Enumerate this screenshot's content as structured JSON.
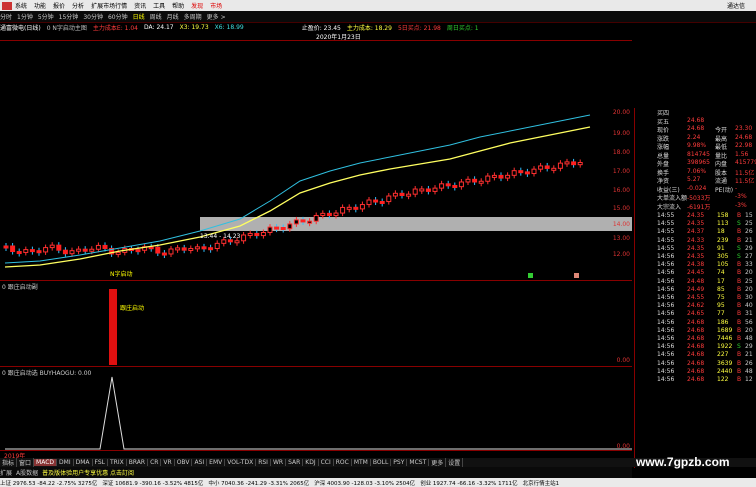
{
  "menu": {
    "items": [
      "系统",
      "功能",
      "报价",
      "分析",
      "扩展市场行情",
      "资讯",
      "工具",
      "帮助"
    ],
    "highlight": [
      "发现",
      "市场"
    ],
    "right": "通达信"
  },
  "periods": {
    "items": [
      "分时",
      "1分钟",
      "5分钟",
      "15分钟",
      "30分钟",
      "60分钟",
      "日线",
      "周线",
      "月线",
      "多周期",
      "更多 >"
    ],
    "selected": "日线"
  },
  "info": {
    "stock": "通富微电(日线)",
    "indicator": "0 N字启动主图",
    "ma": "主力成本E: 1.04",
    "da": "DA: 24.17",
    "x3": "X3: 19.73",
    "x6": "X6: 18.99",
    "stop": "止盈价: 23.45",
    "cost": "主力成本: 18.29",
    "buy1": "5日买点: 21.98",
    "buy2": "周日买点: 1",
    "date": "2020年1月23日"
  },
  "main_chart": {
    "y_labels": [
      "20.00",
      "19.00",
      "18.00",
      "17.00",
      "16.00",
      "15.00",
      "14.00",
      "13.00",
      "12.00"
    ],
    "zone_label": "13.44 - 14.23",
    "signal_text": "N字启动",
    "buy_marker": "买"
  },
  "panel2": {
    "title": "0 跟庄启动副",
    "signal": "跟庄启动",
    "y_labels": [
      "0.00"
    ]
  },
  "panel3": {
    "title": "0 跟庄启动选 BUYHAOGU: 0.00",
    "y_labels": [
      "0.00"
    ]
  },
  "quote": {
    "rows": [
      {
        "l1": "买四",
        "v1": "",
        "l2": "",
        "v2": ""
      },
      {
        "l1": "买五",
        "v1": "24.68",
        "l2": "",
        "v2": ""
      },
      {
        "l1": "现价",
        "v1": "24.68",
        "l2": "今开",
        "v2": "23.30"
      },
      {
        "l1": "涨跌",
        "v1": "2.24",
        "l2": "最高",
        "v2": "24.68"
      },
      {
        "l1": "涨幅",
        "v1": "9.98%",
        "l2": "最低",
        "v2": "22.98"
      },
      {
        "l1": "总量",
        "v1": "814745",
        "l2": "量比",
        "v2": "1.56"
      },
      {
        "l1": "外盘",
        "v1": "398965",
        "l2": "内盘",
        "v2": "415779"
      },
      {
        "l1": "换手",
        "v1": "7.06%",
        "l2": "股本",
        "v2": "11.5亿"
      },
      {
        "l1": "净资",
        "v1": "5.27",
        "l2": "流通",
        "v2": "11.5亿"
      },
      {
        "l1": "收益(三)",
        "v1": "-0.024",
        "l2": "PE(动)",
        "v2": "-"
      },
      {
        "l1": "大单流入额",
        "v1": "-5033万",
        "l2": "",
        "v2": "-3%"
      },
      {
        "l1": "大宗流入",
        "v1": "-6191万",
        "l2": "",
        "v2": "-3%"
      }
    ],
    "ticks": [
      {
        "t": "14:55",
        "p": "24.35",
        "v": "158",
        "d": "B",
        "c": "15"
      },
      {
        "t": "14:55",
        "p": "24.35",
        "v": "113",
        "d": "S",
        "c": "25"
      },
      {
        "t": "14:55",
        "p": "24.37",
        "v": "18",
        "d": "B",
        "c": "26"
      },
      {
        "t": "14:55",
        "p": "24.33",
        "v": "239",
        "d": "B",
        "c": "21"
      },
      {
        "t": "14:55",
        "p": "24.35",
        "v": "91",
        "d": "S",
        "c": "29"
      },
      {
        "t": "14:56",
        "p": "24.35",
        "v": "305",
        "d": "S",
        "c": "27"
      },
      {
        "t": "14:56",
        "p": "24.38",
        "v": "105",
        "d": "B",
        "c": "33"
      },
      {
        "t": "14:56",
        "p": "24.45",
        "v": "74",
        "d": "B",
        "c": "20"
      },
      {
        "t": "14:56",
        "p": "24.48",
        "v": "17",
        "d": "B",
        "c": "25"
      },
      {
        "t": "14:56",
        "p": "24.49",
        "v": "85",
        "d": "B",
        "c": "20"
      },
      {
        "t": "14:56",
        "p": "24.55",
        "v": "75",
        "d": "B",
        "c": "30"
      },
      {
        "t": "14:56",
        "p": "24.62",
        "v": "95",
        "d": "B",
        "c": "40"
      },
      {
        "t": "14:56",
        "p": "24.65",
        "v": "77",
        "d": "B",
        "c": "31"
      },
      {
        "t": "14:56",
        "p": "24.68",
        "v": "186",
        "d": "B",
        "c": "56"
      },
      {
        "t": "14:56",
        "p": "24.68",
        "v": "1689",
        "d": "B",
        "c": "20"
      },
      {
        "t": "14:56",
        "p": "24.68",
        "v": "7446",
        "d": "B",
        "c": "48"
      },
      {
        "t": "14:56",
        "p": "24.68",
        "v": "1922",
        "d": "S",
        "c": "29"
      },
      {
        "t": "14:56",
        "p": "24.68",
        "v": "227",
        "d": "B",
        "c": "21"
      },
      {
        "t": "14:56",
        "p": "24.68",
        "v": "3639",
        "d": "B",
        "c": "26"
      },
      {
        "t": "14:56",
        "p": "24.68",
        "v": "2440",
        "d": "B",
        "c": "48"
      },
      {
        "t": "14:56",
        "p": "24.68",
        "v": "122",
        "d": "B",
        "c": "12"
      }
    ]
  },
  "bottom_tabs": {
    "items": [
      "指标",
      "窗口",
      "MACD",
      "DMI",
      "DMA",
      "FSL",
      "TRIX",
      "BRAR",
      "CR",
      "VR",
      "OBV",
      "ASI",
      "EMV",
      "VOL-TDX",
      "RSI",
      "WR",
      "SAR",
      "KDJ",
      "CCI",
      "ROC",
      "MTM",
      "BOLL",
      "PSY",
      "MCST",
      "更多",
      "设置"
    ],
    "selected": "MACD",
    "left": [
      "扩展",
      "A股数据"
    ],
    "notice": "普及版体验用户专享优惠  点击訂阅"
  },
  "year_label": "2019年",
  "status": {
    "sh": "上证 2976.53 -84.22 -2.75% 3275亿",
    "sz": "深证 10681.9 -390.16 -3.52% 4815亿",
    "zx": "中小 7040.36 -241.29 -3.31% 2065亿",
    "hs": "沪深 4003.90 -128.03 -3.10% 2504亿",
    "cy": "创业 1927.74 -66.16 -3.32% 1711亿",
    "conn": "北京行情主站1"
  },
  "watermark": "www.7gpzb.com"
}
